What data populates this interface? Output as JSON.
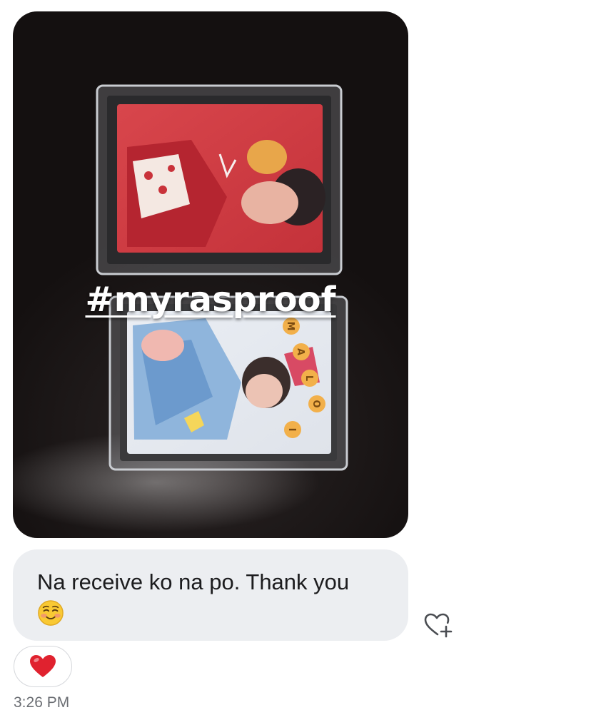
{
  "photo": {
    "overlay_hashtag": "#myrasproof",
    "card_letters": [
      "M",
      "A",
      "L",
      "O",
      "I"
    ]
  },
  "message": {
    "text": "Na receive ko na po. Thank you"
  },
  "reaction": {
    "icon": "red-heart-icon"
  },
  "timestamp": "3:26 PM",
  "colors": {
    "bubble": "#eceef1",
    "heart": "#e0222f",
    "text": "#1c1c1e",
    "timestamp": "#6b6e73"
  }
}
